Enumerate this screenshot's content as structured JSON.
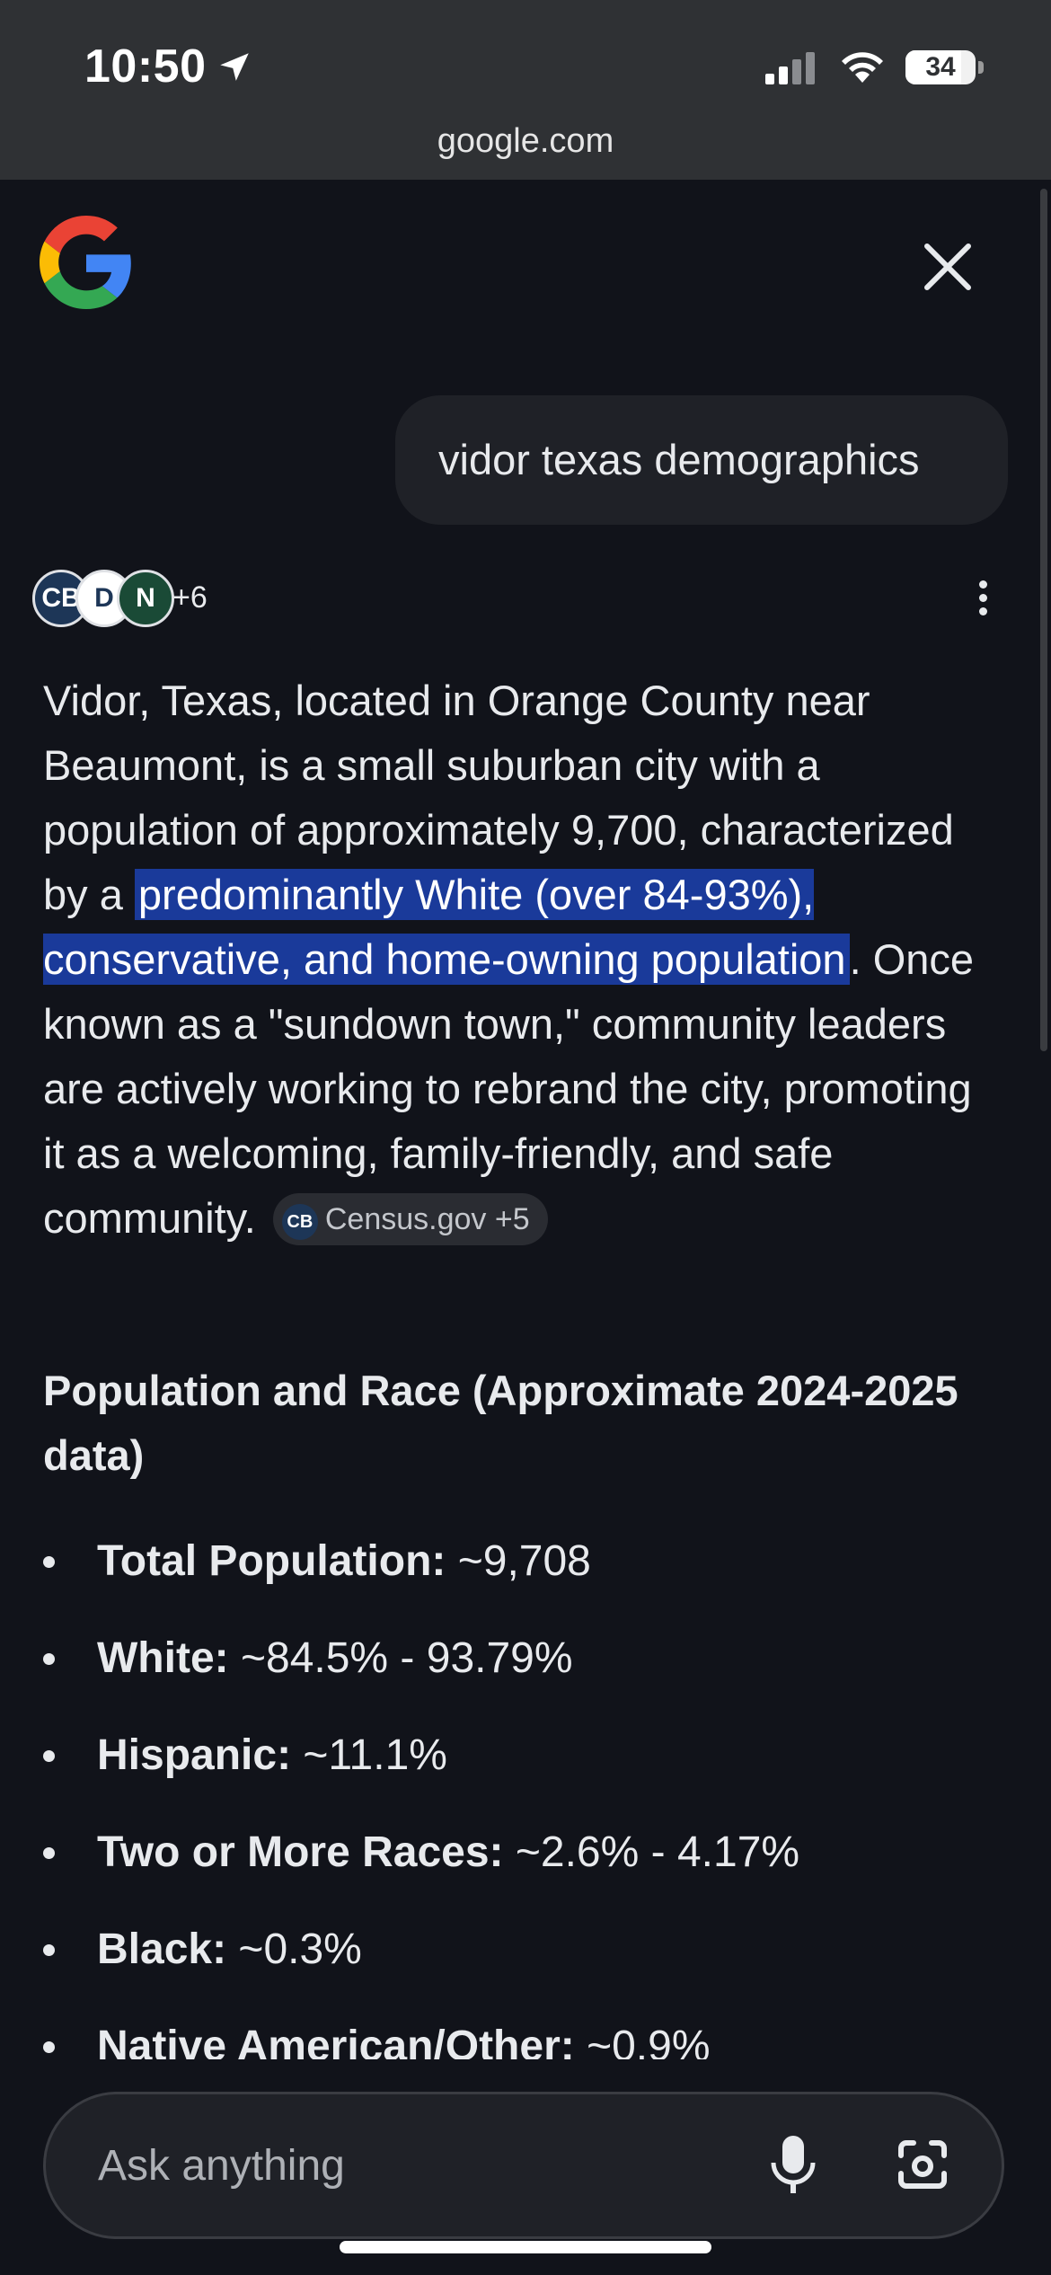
{
  "status_bar": {
    "time": "10:50",
    "battery": "34"
  },
  "browser": {
    "url": "google.com"
  },
  "query": "vidor texas demographics",
  "sources": {
    "icons": [
      "CB",
      "D",
      "N"
    ],
    "more": "+6"
  },
  "answer": {
    "part1": "Vidor, Texas, located in Orange County near Beaumont, is a small suburban city with a population of approximately 9,700, characterized by a ",
    "highlight": "predominantly White (over 84-93%), conservative, and home-owning population",
    "part2": ". Once known as a \"sundown town,\" community leaders are actively working to rebrand the city, promoting it as a welcoming, family-friendly, and safe community.",
    "citation": {
      "icon": "CB",
      "label": "Census.gov +5"
    }
  },
  "section_title": "Population and Race (Approximate 2024-2025 data)",
  "bullets": [
    {
      "label": "Total Population:",
      "value": " ~9,708"
    },
    {
      "label": "White:",
      "value": " ~84.5% - 93.79%"
    },
    {
      "label": "Hispanic:",
      "value": " ~11.1%"
    },
    {
      "label": "Two or More Races:",
      "value": " ~2.6% - 4.17%"
    },
    {
      "label": "Black:",
      "value": " ~0.3%"
    },
    {
      "label": "Native American/Other:",
      "value": " ~0.9%"
    }
  ],
  "ask_bar": {
    "placeholder": "Ask anything"
  }
}
